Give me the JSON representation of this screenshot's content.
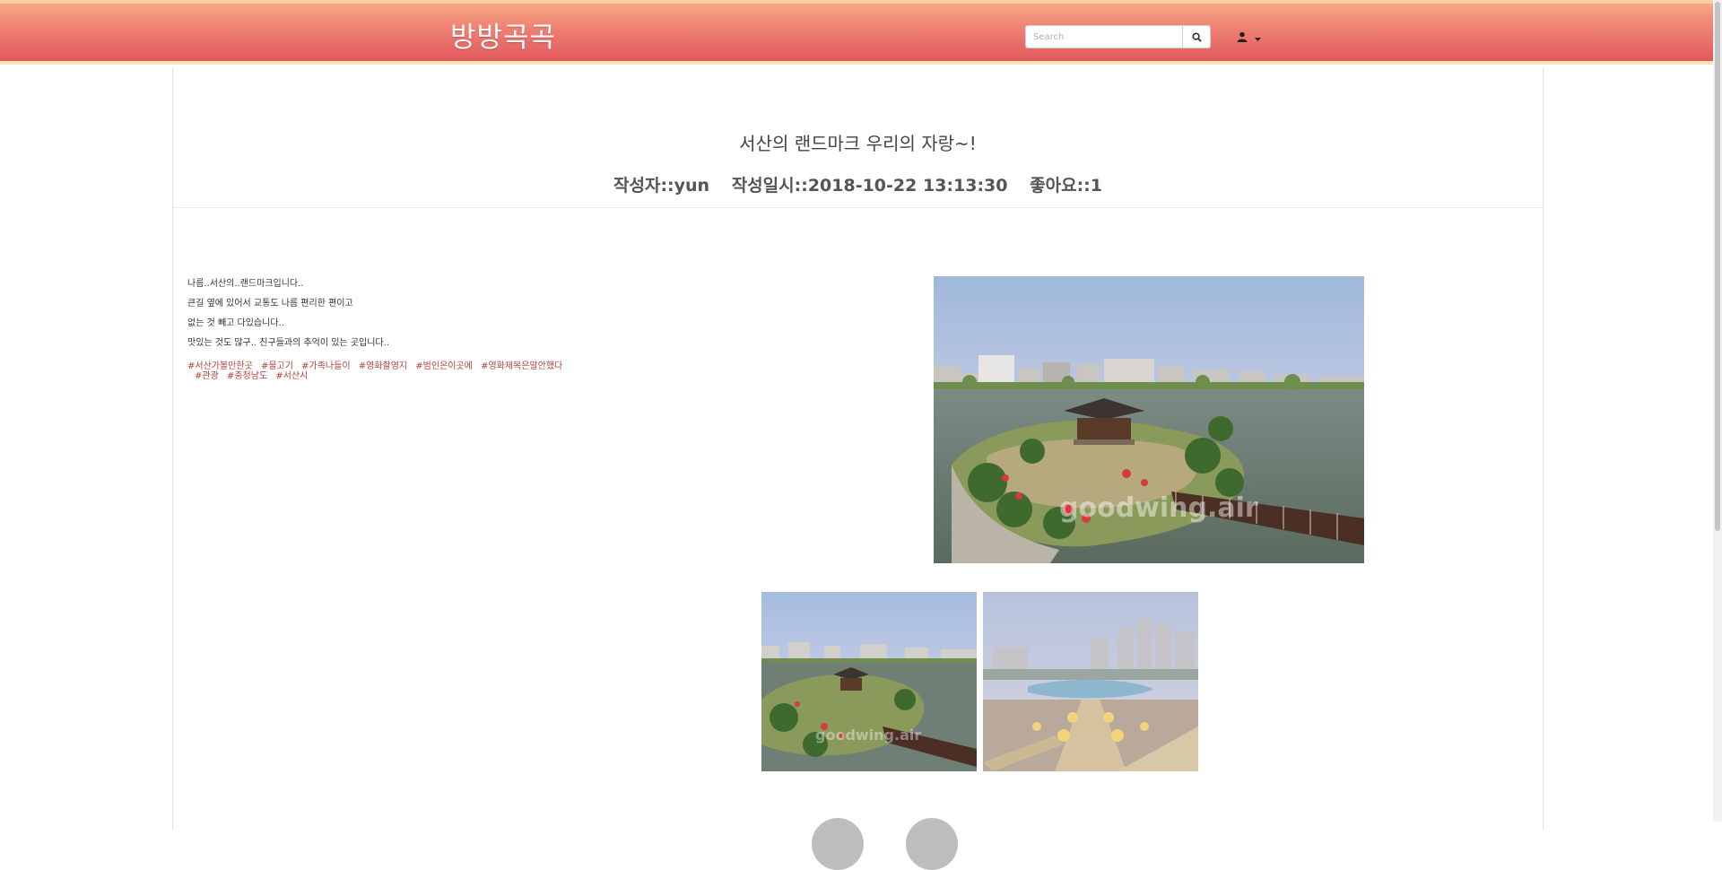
{
  "header": {
    "brand": "방방곡곡",
    "search_placeholder": "Search",
    "search_icon": "search-icon",
    "user_icon": "user-icon",
    "caret_icon": "caret-down-icon"
  },
  "post": {
    "title": "서산의 랜드마크 우리의 자랑~!",
    "author_label": "작성자::yun",
    "date_label": "작성일시::2018-10-22 13:13:30",
    "likes_label": "좋아요::1",
    "lines": [
      "나름..서산의..랜드마크입니다..",
      "큰길 옆에 있어서 교통도 나름 편리한 편이고",
      "없는 것 빼고 다있습니다..",
      "맛있는 것도 많구.. 친구들과의 추억이 있는 곳입니다.."
    ],
    "tags_row1": [
      "#서산가볼만한곳",
      "#물고기",
      "#가족나들이",
      "#영화촬영지",
      "#범인은이곳에",
      "#영화제목은말안했다"
    ],
    "tags_row2": [
      "#관광",
      "#충청남도",
      "#서산시"
    ],
    "watermark": "goodwing.air"
  },
  "colors": {
    "navbar_top": "#f7a886",
    "navbar_bottom": "#e0595c",
    "tag": "#b3423a"
  }
}
